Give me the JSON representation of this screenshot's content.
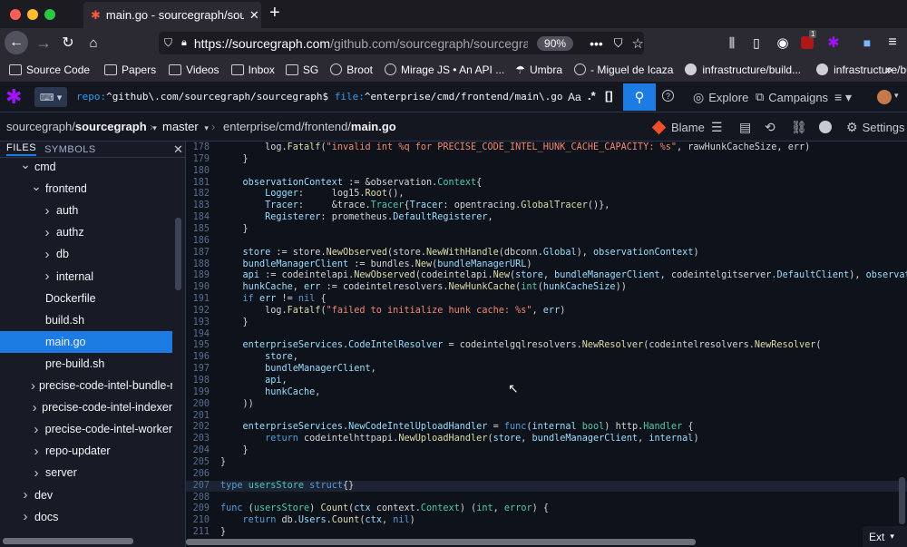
{
  "browser": {
    "tab_title": "main.go - sourcegraph/sourcegraph",
    "url_domain": "https://sourcegraph.com",
    "url_path": "/github.com/sourcegraph/sourcegraph/-/blob/enterprise/cmd/frontend/main.go",
    "zoom": "90%",
    "notif_badge": "1",
    "bookmarks": [
      {
        "label": "Source Code",
        "icon": "folder-icon"
      },
      {
        "label": "Papers",
        "icon": "folder-icon"
      },
      {
        "label": "Videos",
        "icon": "folder-icon"
      },
      {
        "label": "Inbox",
        "icon": "folder-icon"
      },
      {
        "label": "SG",
        "icon": "folder-icon"
      },
      {
        "label": "Broot",
        "icon": "globe-icon"
      },
      {
        "label": "Mirage JS • An API ...",
        "icon": "globe-icon"
      },
      {
        "label": "Umbra",
        "icon": "umbrella-icon"
      },
      {
        "label": "- Miguel de Icaza",
        "icon": "globe-icon"
      },
      {
        "label": "infrastructure/build...",
        "icon": "github-icon"
      },
      {
        "label": "infrastructure/build...",
        "icon": "github-icon"
      }
    ]
  },
  "sg": {
    "query_repo_key": "repo:",
    "query_repo_val": "^github\\.com/sourcegraph/sourcegraph$",
    "query_file_key": "file:",
    "query_file_val": "^enterprise/cmd/frontend/main\\.go",
    "case_toggle": "Aa",
    "regex_toggle": ".*",
    "struct_toggle": "[]",
    "explore": "Explore",
    "campaigns": "Campaigns"
  },
  "repo": {
    "owner": "sourcegraph/",
    "name": "sourcegraph",
    "branch": "master",
    "path_prefix": "enterprise/cmd/frontend/",
    "file": "main.go",
    "blame": "Blame",
    "settings": "Settings"
  },
  "sidebar": {
    "tab_files": "FILES",
    "tab_symbols": "SYMBOLS",
    "items": [
      {
        "label": "cmd",
        "chev": "v",
        "indent": 1
      },
      {
        "label": "frontend",
        "chev": "v",
        "indent": 2
      },
      {
        "label": "auth",
        "chev": ">",
        "indent": 3
      },
      {
        "label": "authz",
        "chev": ">",
        "indent": 3
      },
      {
        "label": "db",
        "chev": ">",
        "indent": 3
      },
      {
        "label": "internal",
        "chev": ">",
        "indent": 3
      },
      {
        "label": "Dockerfile",
        "chev": "",
        "indent": 3
      },
      {
        "label": "build.sh",
        "chev": "",
        "indent": 3
      },
      {
        "label": "main.go",
        "chev": "",
        "indent": 3,
        "selected": true
      },
      {
        "label": "pre-build.sh",
        "chev": "",
        "indent": 3
      },
      {
        "label": "precise-code-intel-bundle-manager",
        "chev": ">",
        "indent": 2
      },
      {
        "label": "precise-code-intel-indexer",
        "chev": ">",
        "indent": 2
      },
      {
        "label": "precise-code-intel-worker",
        "chev": ">",
        "indent": 2
      },
      {
        "label": "repo-updater",
        "chev": ">",
        "indent": 2
      },
      {
        "label": "server",
        "chev": ">",
        "indent": 2
      },
      {
        "label": "dev",
        "chev": ">",
        "indent": 1
      },
      {
        "label": "docs",
        "chev": ">",
        "indent": 1
      }
    ]
  },
  "code_lines": [
    {
      "n": "178",
      "c": [
        [
          "        ",
          "p"
        ],
        [
          "log",
          "n"
        ],
        [
          ".",
          "p"
        ],
        [
          "Fatalf",
          "f"
        ],
        [
          "(",
          "p"
        ],
        [
          "\"invalid int %q for PRECISE_CODE_INTEL_HUNK_CACHE_CAPACITY: %s\"",
          "s"
        ],
        [
          ", ",
          "p"
        ],
        [
          "rawHunkCacheSize",
          "n"
        ],
        [
          ", ",
          "p"
        ],
        [
          "err",
          "n"
        ],
        [
          ")",
          "p"
        ]
      ]
    },
    {
      "n": "179",
      "c": [
        [
          "    }",
          "p"
        ]
      ]
    },
    {
      "n": "180",
      "c": []
    },
    {
      "n": "181",
      "c": [
        [
          "    ",
          "p"
        ],
        [
          "observationContext",
          "v"
        ],
        [
          " := &",
          "p"
        ],
        [
          "observation",
          "n"
        ],
        [
          ".",
          "p"
        ],
        [
          "Context",
          "t"
        ],
        [
          "{",
          "p"
        ]
      ]
    },
    {
      "n": "182",
      "c": [
        [
          "        ",
          "p"
        ],
        [
          "Logger",
          "v"
        ],
        [
          ":     ",
          "p"
        ],
        [
          "log15",
          "n"
        ],
        [
          ".",
          "p"
        ],
        [
          "Root",
          "f"
        ],
        [
          "(),",
          "p"
        ]
      ]
    },
    {
      "n": "183",
      "c": [
        [
          "        ",
          "p"
        ],
        [
          "Tracer",
          "v"
        ],
        [
          ":     &",
          "p"
        ],
        [
          "trace",
          "n"
        ],
        [
          ".",
          "p"
        ],
        [
          "Tracer",
          "t"
        ],
        [
          "{",
          "p"
        ],
        [
          "Tracer",
          "v"
        ],
        [
          ": ",
          "p"
        ],
        [
          "opentracing",
          "n"
        ],
        [
          ".",
          "p"
        ],
        [
          "GlobalTracer",
          "f"
        ],
        [
          "()},",
          "p"
        ]
      ]
    },
    {
      "n": "184",
      "c": [
        [
          "        ",
          "p"
        ],
        [
          "Registerer",
          "v"
        ],
        [
          ": ",
          "p"
        ],
        [
          "prometheus",
          "n"
        ],
        [
          ".",
          "p"
        ],
        [
          "DefaultRegisterer",
          "v"
        ],
        [
          ",",
          "p"
        ]
      ]
    },
    {
      "n": "185",
      "c": [
        [
          "    }",
          "p"
        ]
      ]
    },
    {
      "n": "186",
      "c": []
    },
    {
      "n": "187",
      "c": [
        [
          "    ",
          "p"
        ],
        [
          "store",
          "v"
        ],
        [
          " := ",
          "p"
        ],
        [
          "store",
          "n"
        ],
        [
          ".",
          "p"
        ],
        [
          "NewObserved",
          "f"
        ],
        [
          "(",
          "p"
        ],
        [
          "store",
          "n"
        ],
        [
          ".",
          "p"
        ],
        [
          "NewWithHandle",
          "f"
        ],
        [
          "(",
          "p"
        ],
        [
          "dbconn",
          "n"
        ],
        [
          ".",
          "p"
        ],
        [
          "Global",
          "v"
        ],
        [
          "), ",
          "p"
        ],
        [
          "observationContext",
          "v"
        ],
        [
          ")",
          "p"
        ]
      ]
    },
    {
      "n": "188",
      "c": [
        [
          "    ",
          "p"
        ],
        [
          "bundleManagerClient",
          "v"
        ],
        [
          " := ",
          "p"
        ],
        [
          "bundles",
          "n"
        ],
        [
          ".",
          "p"
        ],
        [
          "New",
          "f"
        ],
        [
          "(",
          "p"
        ],
        [
          "bundleManagerURL",
          "v"
        ],
        [
          ")",
          "p"
        ]
      ]
    },
    {
      "n": "189",
      "c": [
        [
          "    ",
          "p"
        ],
        [
          "api",
          "v"
        ],
        [
          " := ",
          "p"
        ],
        [
          "codeintelapi",
          "n"
        ],
        [
          ".",
          "p"
        ],
        [
          "NewObserved",
          "f"
        ],
        [
          "(",
          "p"
        ],
        [
          "codeintelapi",
          "n"
        ],
        [
          ".",
          "p"
        ],
        [
          "New",
          "f"
        ],
        [
          "(",
          "p"
        ],
        [
          "store",
          "v"
        ],
        [
          ", ",
          "p"
        ],
        [
          "bundleManagerClient",
          "v"
        ],
        [
          ", ",
          "p"
        ],
        [
          "codeintelgitserver",
          "n"
        ],
        [
          ".",
          "p"
        ],
        [
          "DefaultClient",
          "v"
        ],
        [
          "), ",
          "p"
        ],
        [
          "observationContext",
          "v"
        ],
        [
          ")",
          "p"
        ]
      ]
    },
    {
      "n": "190",
      "c": [
        [
          "    ",
          "p"
        ],
        [
          "hunkCache",
          "v"
        ],
        [
          ", ",
          "p"
        ],
        [
          "err",
          "v"
        ],
        [
          " := ",
          "p"
        ],
        [
          "codeintelresolvers",
          "n"
        ],
        [
          ".",
          "p"
        ],
        [
          "NewHunkCache",
          "f"
        ],
        [
          "(",
          "p"
        ],
        [
          "int",
          "t"
        ],
        [
          "(",
          "p"
        ],
        [
          "hunkCacheSize",
          "v"
        ],
        [
          "))",
          "p"
        ]
      ]
    },
    {
      "n": "191",
      "c": [
        [
          "    ",
          "p"
        ],
        [
          "if",
          "k"
        ],
        [
          " ",
          "p"
        ],
        [
          "err",
          "v"
        ],
        [
          " != ",
          "p"
        ],
        [
          "nil",
          "k"
        ],
        [
          " {",
          "p"
        ]
      ]
    },
    {
      "n": "192",
      "c": [
        [
          "        ",
          "p"
        ],
        [
          "log",
          "n"
        ],
        [
          ".",
          "p"
        ],
        [
          "Fatalf",
          "f"
        ],
        [
          "(",
          "p"
        ],
        [
          "\"failed to initialize hunk cache: %s\"",
          "s"
        ],
        [
          ", ",
          "p"
        ],
        [
          "err",
          "v"
        ],
        [
          ")",
          "p"
        ]
      ]
    },
    {
      "n": "193",
      "c": [
        [
          "    }",
          "p"
        ]
      ]
    },
    {
      "n": "194",
      "c": []
    },
    {
      "n": "195",
      "c": [
        [
          "    ",
          "p"
        ],
        [
          "enterpriseServices",
          "v"
        ],
        [
          ".",
          "p"
        ],
        [
          "CodeIntelResolver",
          "v"
        ],
        [
          " = ",
          "p"
        ],
        [
          "codeintelgqlresolvers",
          "n"
        ],
        [
          ".",
          "p"
        ],
        [
          "NewResolver",
          "f"
        ],
        [
          "(",
          "p"
        ],
        [
          "codeintelresolvers",
          "n"
        ],
        [
          ".",
          "p"
        ],
        [
          "NewResolver",
          "f"
        ],
        [
          "(",
          "p"
        ]
      ]
    },
    {
      "n": "196",
      "c": [
        [
          "        ",
          "p"
        ],
        [
          "store",
          "v"
        ],
        [
          ",",
          "p"
        ]
      ]
    },
    {
      "n": "197",
      "c": [
        [
          "        ",
          "p"
        ],
        [
          "bundleManagerClient",
          "v"
        ],
        [
          ",",
          "p"
        ]
      ]
    },
    {
      "n": "198",
      "c": [
        [
          "        ",
          "p"
        ],
        [
          "api",
          "v"
        ],
        [
          ",",
          "p"
        ]
      ]
    },
    {
      "n": "199",
      "c": [
        [
          "        ",
          "p"
        ],
        [
          "hunkCache",
          "v"
        ],
        [
          ",",
          "p"
        ]
      ]
    },
    {
      "n": "200",
      "c": [
        [
          "    ))",
          "p"
        ]
      ]
    },
    {
      "n": "201",
      "c": []
    },
    {
      "n": "202",
      "c": [
        [
          "    ",
          "p"
        ],
        [
          "enterpriseServices",
          "v"
        ],
        [
          ".",
          "p"
        ],
        [
          "NewCodeIntelUploadHandler",
          "v"
        ],
        [
          " = ",
          "p"
        ],
        [
          "func",
          "k"
        ],
        [
          "(",
          "p"
        ],
        [
          "internal",
          "v"
        ],
        [
          " ",
          "p"
        ],
        [
          "bool",
          "t"
        ],
        [
          ") ",
          "p"
        ],
        [
          "http",
          "n"
        ],
        [
          ".",
          "p"
        ],
        [
          "Handler",
          "t"
        ],
        [
          " {",
          "p"
        ]
      ]
    },
    {
      "n": "203",
      "c": [
        [
          "        ",
          "p"
        ],
        [
          "return",
          "k"
        ],
        [
          " ",
          "p"
        ],
        [
          "codeintelhttpapi",
          "n"
        ],
        [
          ".",
          "p"
        ],
        [
          "NewUploadHandler",
          "f"
        ],
        [
          "(",
          "p"
        ],
        [
          "store",
          "v"
        ],
        [
          ", ",
          "p"
        ],
        [
          "bundleManagerClient",
          "v"
        ],
        [
          ", ",
          "p"
        ],
        [
          "internal",
          "v"
        ],
        [
          ")",
          "p"
        ]
      ]
    },
    {
      "n": "204",
      "c": [
        [
          "    }",
          "p"
        ]
      ]
    },
    {
      "n": "205",
      "c": [
        [
          "}",
          "p"
        ]
      ]
    },
    {
      "n": "206",
      "c": []
    },
    {
      "n": "207",
      "c": [
        [
          "type",
          "k"
        ],
        [
          " ",
          "p"
        ],
        [
          "usersStore",
          "t"
        ],
        [
          " ",
          "p"
        ],
        [
          "struct",
          "k"
        ],
        [
          "{}",
          "p"
        ]
      ],
      "hl": true
    },
    {
      "n": "208",
      "c": []
    },
    {
      "n": "209",
      "c": [
        [
          "func",
          "k"
        ],
        [
          " (",
          "p"
        ],
        [
          "usersStore",
          "t"
        ],
        [
          ") ",
          "p"
        ],
        [
          "Count",
          "f"
        ],
        [
          "(",
          "p"
        ],
        [
          "ctx",
          "v"
        ],
        [
          " ",
          "p"
        ],
        [
          "context",
          "n"
        ],
        [
          ".",
          "p"
        ],
        [
          "Context",
          "t"
        ],
        [
          ") (",
          "p"
        ],
        [
          "int",
          "t"
        ],
        [
          ", ",
          "p"
        ],
        [
          "error",
          "t"
        ],
        [
          ") {",
          "p"
        ]
      ]
    },
    {
      "n": "210",
      "c": [
        [
          "    ",
          "p"
        ],
        [
          "return",
          "k"
        ],
        [
          " ",
          "p"
        ],
        [
          "db",
          "n"
        ],
        [
          ".",
          "p"
        ],
        [
          "Users",
          "v"
        ],
        [
          ".",
          "p"
        ],
        [
          "Count",
          "f"
        ],
        [
          "(",
          "p"
        ],
        [
          "ctx",
          "v"
        ],
        [
          ", ",
          "p"
        ],
        [
          "nil",
          "k"
        ],
        [
          ")",
          "p"
        ]
      ]
    },
    {
      "n": "211",
      "c": [
        [
          "}",
          "p"
        ]
      ]
    }
  ],
  "ext_label": "Ext",
  "colors": {
    "accent": "#1d7be4",
    "bg": "#0e121b",
    "sidebar_bg": "#181b26"
  }
}
